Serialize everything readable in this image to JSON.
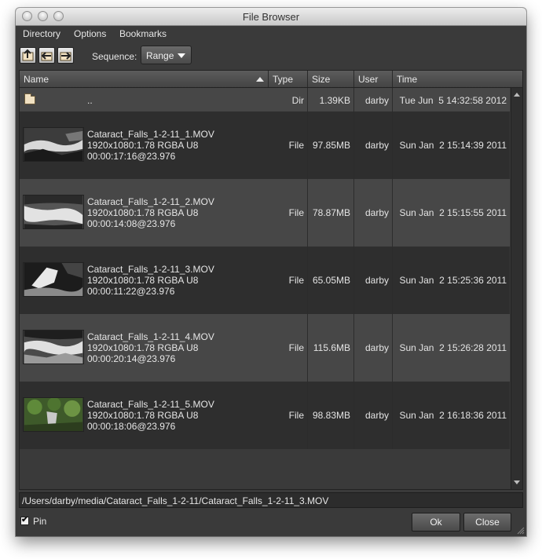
{
  "window": {
    "title": "File Browser"
  },
  "menu": {
    "items": [
      "Directory",
      "Options",
      "Bookmarks"
    ]
  },
  "toolbar": {
    "buttons": [
      {
        "icon": "folder-up-icon"
      },
      {
        "icon": "folder-back-icon"
      },
      {
        "icon": "folder-forward-icon"
      }
    ],
    "sequence_label": "Sequence:",
    "sequence_value": "Range"
  },
  "columns": {
    "name": "Name",
    "type": "Type",
    "size": "Size",
    "user": "User",
    "time": "Time"
  },
  "parent_row": {
    "name": "..",
    "type": "Dir",
    "size": "1.39KB",
    "user": "darby",
    "time": "Tue Jun  5 14:32:58 2012"
  },
  "files": [
    {
      "name": "Cataract_Falls_1-2-11_1.MOV",
      "res": "1920x1080:1.78 RGBA U8",
      "tc": "00:00:17:16@23.976",
      "type": "File",
      "size": "97.85MB",
      "user": "darby",
      "time": "Sun Jan  2 15:14:39 2011"
    },
    {
      "name": "Cataract_Falls_1-2-11_2.MOV",
      "res": "1920x1080:1.78 RGBA U8",
      "tc": "00:00:14:08@23.976",
      "type": "File",
      "size": "78.87MB",
      "user": "darby",
      "time": "Sun Jan  2 15:15:55 2011"
    },
    {
      "name": "Cataract_Falls_1-2-11_3.MOV",
      "res": "1920x1080:1.78 RGBA U8",
      "tc": "00:00:11:22@23.976",
      "type": "File",
      "size": "65.05MB",
      "user": "darby",
      "time": "Sun Jan  2 15:25:36 2011"
    },
    {
      "name": "Cataract_Falls_1-2-11_4.MOV",
      "res": "1920x1080:1.78 RGBA U8",
      "tc": "00:00:20:14@23.976",
      "type": "File",
      "size": "115.6MB",
      "user": "darby",
      "time": "Sun Jan  2 15:26:28 2011"
    },
    {
      "name": "Cataract_Falls_1-2-11_5.MOV",
      "res": "1920x1080:1.78 RGBA U8",
      "tc": "00:00:18:06@23.976",
      "type": "File",
      "size": "98.83MB",
      "user": "darby",
      "time": "Sun Jan  2 16:18:36 2011"
    }
  ],
  "path": "/Users/darby/media/Cataract_Falls_1-2-11/Cataract_Falls_1-2-11_3.MOV",
  "pin": {
    "label": "Pin",
    "checked": true
  },
  "buttons": {
    "ok": "Ok",
    "close": "Close"
  },
  "colors": {
    "row_dark": "#2e2e2e",
    "row_light": "#474747",
    "window_bg": "#3a3a3a"
  }
}
